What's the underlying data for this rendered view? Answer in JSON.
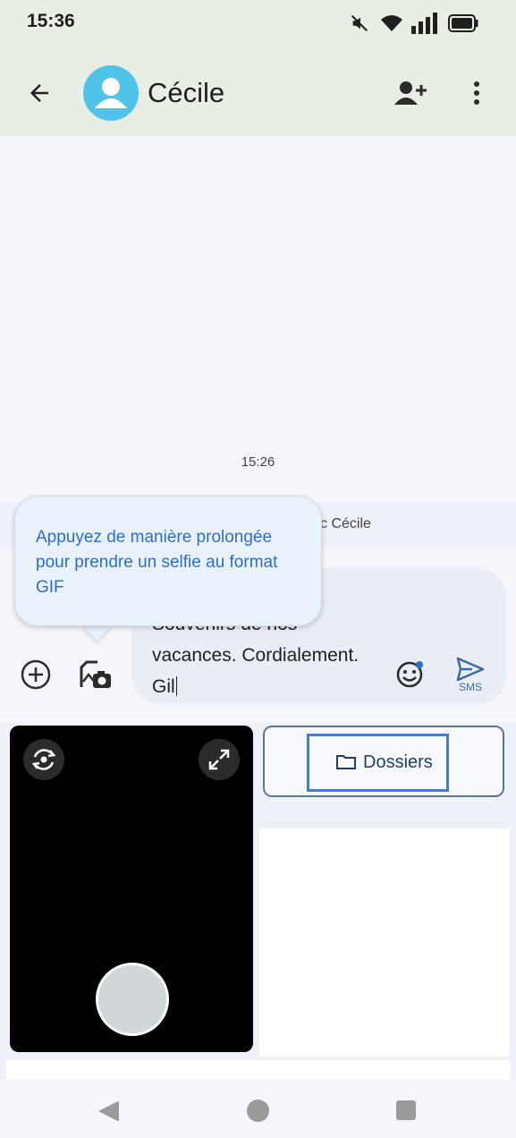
{
  "status_bar": {
    "time": "15:36",
    "icons": [
      "mute-icon",
      "wifi-icon",
      "signal-icon",
      "battery-icon"
    ]
  },
  "header": {
    "contact_name": "Cécile",
    "icons": [
      "back-arrow-icon",
      "avatar-icon",
      "add-contact-icon",
      "more-vert-icon"
    ]
  },
  "conversation": {
    "timestamp": "15:26",
    "info_text_partial": "c Cécile"
  },
  "composer": {
    "message_text": "Souvenirs de nos\nvacances. Cordialement.\nGil",
    "send_label": "SMS",
    "icons": [
      "add-circle-icon",
      "gif-camera-icon",
      "emoji-icon",
      "send-icon"
    ]
  },
  "tooltip": {
    "text": "Appuyez de manière prolongée pour prendre un selfie au format GIF"
  },
  "media_picker": {
    "folders_label": "Dossiers",
    "icons": [
      "switch-camera-icon",
      "expand-icon",
      "shutter-icon",
      "folder-icon"
    ]
  },
  "colors": {
    "header_bg": "#e9eee4",
    "accent": "#2d6ec6",
    "avatar": "#4fc3e8",
    "focus_outline": "#4a7bd4"
  }
}
